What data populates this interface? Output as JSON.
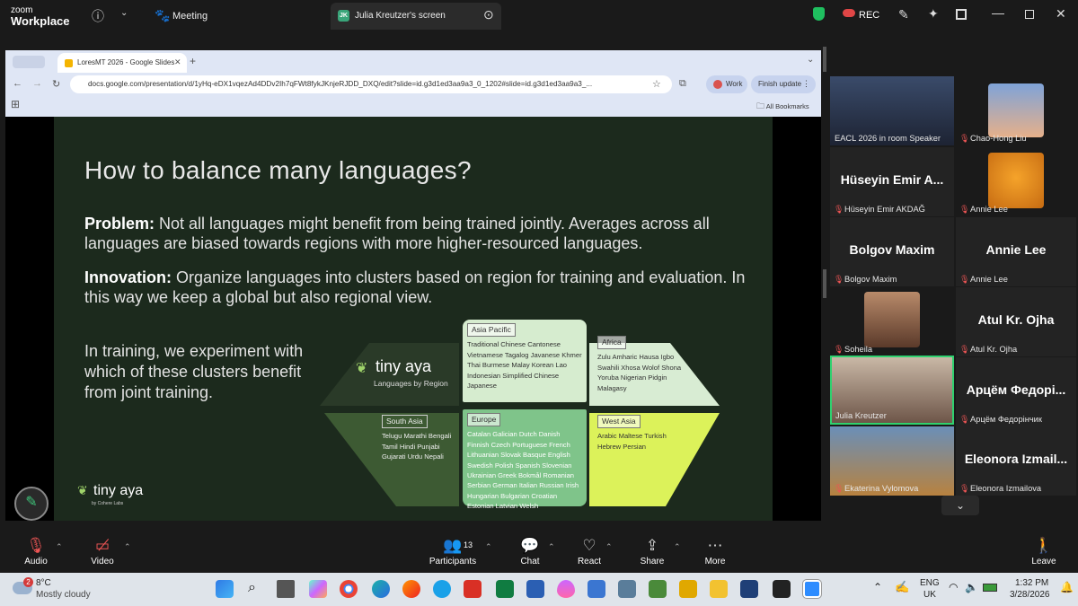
{
  "zoom": {
    "logo_line1": "zoom",
    "logo_line2": "Workplace",
    "meeting_label": "Meeting",
    "screen_tab": "Julia Kreutzer's screen",
    "screen_initials": "JK",
    "rec_label": "REC"
  },
  "browser": {
    "tab_title": "LoresMT 2026 - Google Slides",
    "url": "docs.google.com/presentation/d/1yHq-eDX1vqezAd4DDv2Ih7qFWt8fykJKnjeRJDD_DXQ/edit?slide=id.g3d1ed3aa9a3_0_1202#slide=id.g3d1ed3aa9a3_...",
    "profile_label": "Work",
    "finish_update": "Finish update",
    "bookmarks": "All Bookmarks"
  },
  "slide": {
    "title": "How to balance many languages?",
    "problem_label": "Problem:",
    "problem_text": " Not all languages might benefit from being trained jointly. Averages across all languages are biased towards regions with more higher-resourced languages.",
    "innovation_label": "Innovation:",
    "innovation_text": " Organize languages into clusters based on region for training and evaluation. In this way we keep a global but also regional view.",
    "training_text": "In training, we experiment with which of these clusters benefit from joint training.",
    "brand": "tiny aya",
    "brand_sub": "Languages by Region",
    "footer_brand": "tiny aya",
    "footer_sub": "by Cohere Labs",
    "clusters": {
      "asia_pacific": {
        "title": "Asia Pacific",
        "langs": "Traditional Chinese  Cantonese  Vietnamese  Tagalog  Javanese  Khmer  Thai  Burmese  Malay  Korean  Lao  Indonesian  Simplified Chinese  Japanese"
      },
      "africa": {
        "title": "Africa",
        "langs": "Zulu  Amharic  Hausa  Igbo  Swahili  Xhosa  Wolof  Shona  Yoruba  Nigerian Pidgin  Malagasy"
      },
      "south_asia": {
        "title": "South Asia",
        "langs": "Telugu  Marathi  Bengali  Tamil  Hindi  Punjabi  Gujarati  Urdu  Nepali"
      },
      "europe": {
        "title": "Europe",
        "langs": "Catalan  Galician  Dutch  Danish  Finnish  Czech  Portuguese  French  Lithuanian  Slovak  Basque  English  Swedish  Polish  Spanish  Slovenian  Ukrainian  Greek  Bokmål  Romanian  Serbian  German  Italian  Russian  Irish  Hungarian  Bulgarian  Croatian  Estonian  Latvian  Welsh"
      },
      "west_asia": {
        "title": "West Asia",
        "langs": "Arabic  Maltese  Turkish  Hebrew  Persian"
      }
    }
  },
  "participants": [
    {
      "label": "EACL 2026 in room Speaker"
    },
    {
      "label": "Chao-Hong Liu"
    },
    {
      "name": "Hüseyin Emir A...",
      "label": "Hüseyin Emir AKDAĞ"
    },
    {
      "label": "Annie Lee"
    },
    {
      "name": "Bolgov Maxim",
      "label": "Bolgov Maxim"
    },
    {
      "name": "Annie Lee",
      "label": "Annie Lee"
    },
    {
      "label": "Soheila"
    },
    {
      "name": "Atul Kr. Ojha",
      "label": "Atul Kr. Ojha"
    },
    {
      "label": "Julia Kreutzer"
    },
    {
      "name": "Арцём Федорі...",
      "label": "Арцём Федорінчик"
    },
    {
      "label": "Ekaterina Vylomova"
    },
    {
      "name": "Eleonora Izmail...",
      "label": "Eleonora Izmailova"
    }
  ],
  "controls": {
    "audio": "Audio",
    "video": "Video",
    "participants": "Participants",
    "participants_count": "13",
    "chat": "Chat",
    "react": "React",
    "share": "Share",
    "more": "More",
    "leave": "Leave"
  },
  "taskbar": {
    "weather_badge": "2",
    "temp": "8°C",
    "weather": "Mostly cloudy",
    "lang1": "ENG",
    "lang2": "UK",
    "time": "1:32 PM",
    "date": "3/28/2026"
  }
}
